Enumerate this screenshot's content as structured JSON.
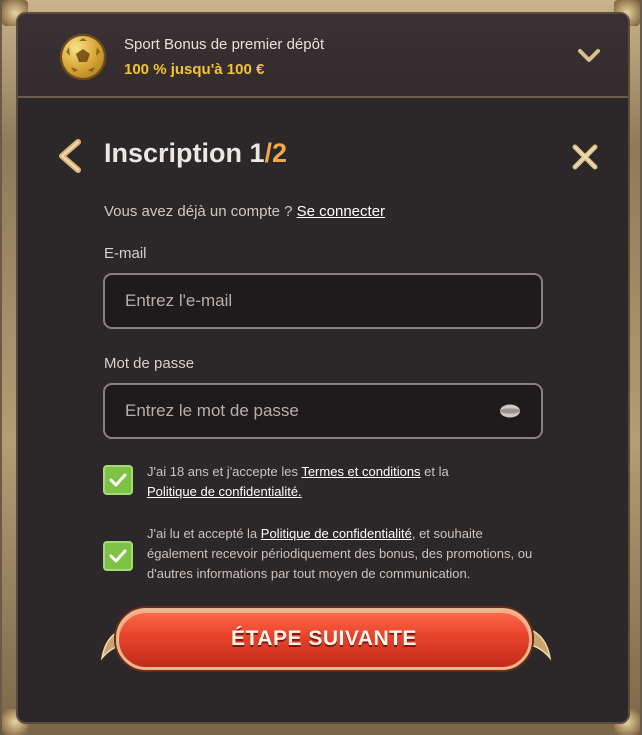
{
  "bonus": {
    "title": "Sport Bonus de premier dépôt",
    "subtitle": "100 % jusqu'à 100 €",
    "icon": "football-icon",
    "expand_icon": "chevron-down-icon"
  },
  "header": {
    "title_text": "Inscription ",
    "step": "1",
    "total": "/2",
    "back_icon": "chevron-left-icon",
    "close_icon": "close-icon"
  },
  "login_prompt": {
    "text": "Vous avez déjà un compte ? ",
    "link": "Se connecter"
  },
  "email": {
    "label": "E-mail",
    "placeholder": "Entrez l'e-mail",
    "value": ""
  },
  "password": {
    "label": "Mot de passe",
    "placeholder": "Entrez le mot de passe",
    "value": "",
    "toggle_icon": "eye-icon"
  },
  "consents": [
    {
      "checked": true,
      "text_before": "J'ai 18 ans et j'accepte les ",
      "link1": "Termes et conditions",
      "text_middle": " et la ",
      "link2": "Politique de confidentialité.",
      "text_after": ""
    },
    {
      "checked": true,
      "text_before": "J'ai lu et accepté la ",
      "link1": "Politique de confidentialité",
      "text_after": ", et souhaite également recevoir périodiquement des bonus, des promotions, ou d'autres informations par tout moyen de communication."
    }
  ],
  "cta": {
    "label": "ÉTAPE SUIVANTE"
  },
  "colors": {
    "panel_bg": "#2c2729",
    "accent_orange": "#f0a84a",
    "bonus_yellow": "#f2c430",
    "check_green": "#7dc244",
    "cta_red": "#e8432b"
  }
}
